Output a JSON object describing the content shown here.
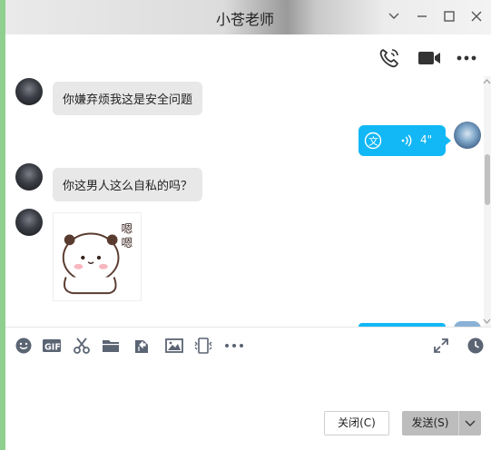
{
  "window": {
    "title": "小苍老师"
  },
  "colors": {
    "accent": "#12b7f5",
    "bubble_in": "#e8e8e8",
    "send_button": "#bdbdbd"
  },
  "messages": [
    {
      "side": "left",
      "type": "text",
      "text": "你嫌弃烦我这是安全问题"
    },
    {
      "side": "right",
      "type": "voice",
      "duration": "4\""
    },
    {
      "side": "left",
      "type": "text",
      "text": "你这男人这么自私的吗？"
    },
    {
      "side": "left",
      "type": "sticker",
      "sticker_text": "嗯嗯"
    }
  ],
  "chat_toolbar": {
    "icons": [
      "voice-call-icon",
      "video-call-icon",
      "more-icon"
    ]
  },
  "input_toolbar": {
    "icons": [
      "emoji-icon",
      "gif-icon",
      "screenshot-icon",
      "folder-icon",
      "file-transfer-icon",
      "image-icon",
      "screen-capture-icon",
      "more-icon",
      "expand-icon",
      "history-icon"
    ],
    "gif_label": "GIF"
  },
  "footer": {
    "close_label": "关闭(C)",
    "send_label": "发送(S)"
  }
}
